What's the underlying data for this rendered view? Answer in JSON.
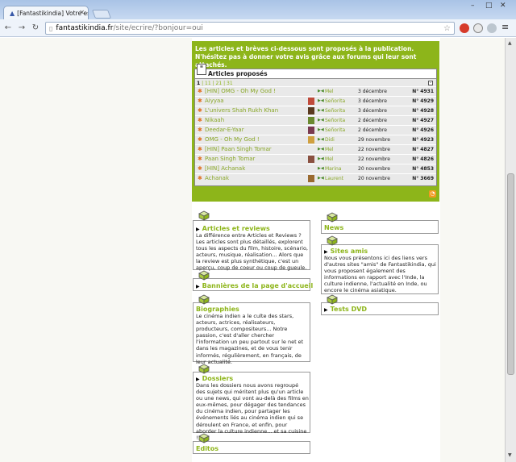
{
  "browser": {
    "tab_title": "[Fantastikindia] Votre esp",
    "url_host": "fantastikindia.fr",
    "url_path": "/site/ecrire/?bonjour=oui"
  },
  "proposed": {
    "intro": "Les articles et brèves ci-dessous sont proposés à la publication. N'hésitez pas à donner votre avis grâce aux forums qui leur sont attachés.",
    "header": "Articles proposés",
    "pager_current": "1",
    "pager_links": [
      "11",
      "21",
      "31"
    ],
    "rows": [
      {
        "title": "[HIN] OMG - Oh My God !",
        "author": "Mel",
        "date": "3 décembre",
        "num": "N° 4931",
        "thumb": ""
      },
      {
        "title": "Aiyyaa",
        "author": "Señorita",
        "date": "3 décembre",
        "num": "N° 4929",
        "thumb": "#c04a3a"
      },
      {
        "title": "L'univers Shah Rukh Khan",
        "author": "Señorita",
        "date": "3 décembre",
        "num": "N° 4928",
        "thumb": "#5a3a20"
      },
      {
        "title": "Nikaah",
        "author": "Señorita",
        "date": "2 décembre",
        "num": "N° 4927",
        "thumb": "#6a8a30"
      },
      {
        "title": "Deedar-E-Yaar",
        "author": "Señorita",
        "date": "2 décembre",
        "num": "N° 4926",
        "thumb": "#7a3a50"
      },
      {
        "title": "OMG - Oh My God !",
        "author": "Didi",
        "date": "29 novembre",
        "num": "N° 4923",
        "thumb": "#d0a040"
      },
      {
        "title": "[HIN] Paan Singh Tomar",
        "author": "Mel",
        "date": "22 novembre",
        "num": "N° 4827",
        "thumb": ""
      },
      {
        "title": "Paan Singh Tomar",
        "author": "Mel",
        "date": "22 novembre",
        "num": "N° 4826",
        "thumb": "#8a5040"
      },
      {
        "title": "[HIN] Achanak",
        "author": "Marina",
        "date": "20 novembre",
        "num": "N° 4853",
        "thumb": ""
      },
      {
        "title": "Achanak",
        "author": "Laurent",
        "date": "20 novembre",
        "num": "N° 3669",
        "thumb": "#9a6a30"
      }
    ]
  },
  "sections": {
    "articles": {
      "title": "Articles et reviews",
      "text": "La différence entre Articles et Reviews ? Les articles sont plus détaillés, explorent tous les aspects du film, histoire, scénario, acteurs, musique, réalisation... Alors que la review est plus synthétique, c'est un aperçu, coup de coeur ou coup de gueule."
    },
    "bannieres": {
      "title": "Bannières de la page d'accueil"
    },
    "biographies": {
      "title": "Biographies",
      "text": "Le cinéma indien a le culte des stars, acteurs, actrices, réalisateurs, producteurs, compositeurs... Notre passion, c'est d'aller chercher l'information un peu partout sur le net et dans les magazines, et de vous tenir informés, régulièrement, en français, de leur actualité."
    },
    "dossiers": {
      "title": "Dossiers",
      "text": "Dans les dossiers nous avons regroupé des sujets qui méritent plus qu'un article ou une news, qui vont au-delà des films en eux-mêmes, pour dégager des tendances du cinéma indien, pour partager les événements liés au cinéma indien qui se déroulent en France, et enfin, pour aborder la culture indienne... et sa cuisine !"
    },
    "editos": {
      "title": "Editos"
    },
    "news": {
      "title": "News"
    },
    "sites": {
      "title": "Sites amis",
      "text": "Nous vous présentons ici des liens vers d'autres sites \"amis\" de Fantastikindia, qui vous proposent également des informations en rapport avec l'Inde, la culture indienne, l'actualité en Inde, ou encore le cinéma asiatique."
    },
    "tests": {
      "title": "Tests DVD"
    }
  },
  "colors": {
    "accent": "#8db51a",
    "bullet": "#e07020",
    "rss": "#f29a21"
  }
}
